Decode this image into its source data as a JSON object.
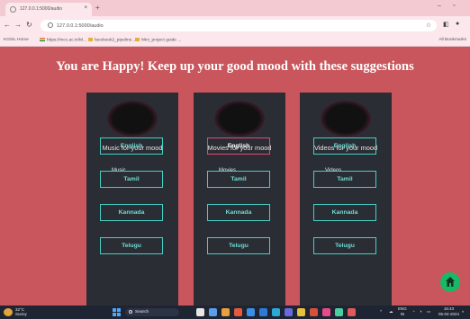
{
  "browser": {
    "tab_title": "127.0.0.1:5000/audio",
    "tab_close": "×",
    "new_tab": "+",
    "url": "127.0.0.1:5000/audio",
    "bookmarks": [
      "KGiSL Home",
      "https://mcc.ac.in/M...",
      "facebook2_pipeline...",
      "Mini_project guide ..."
    ],
    "all_bookmarks": "All Bookmarks"
  },
  "page": {
    "headline": "You are Happy! Keep up your good mood with these suggestions",
    "cards": [
      {
        "title": "Music for your mood",
        "subtitle": "Music",
        "buttons": [
          "English",
          "Tamil",
          "Kannada",
          "Telugu"
        ],
        "active_index": -1
      },
      {
        "title": "Movies for your mood",
        "subtitle": "Movies",
        "buttons": [
          "English",
          "Tamil",
          "Kannada",
          "Telugu"
        ],
        "active_index": 0
      },
      {
        "title": "Videos for your mood",
        "subtitle": "Videos",
        "buttons": [
          "English",
          "Tamil",
          "Kannada",
          "Telugu"
        ],
        "active_index": -1
      }
    ]
  },
  "taskbar": {
    "temperature": "32°C",
    "weather": "Sunny",
    "search_placeholder": "Search",
    "language": "ENG",
    "region": "IN",
    "time": "16:43",
    "date": "05-04-2024"
  },
  "colors": {
    "page_background": "#c9565c",
    "card_background": "#2b2d34",
    "button_border": "#44cfc6",
    "active_button_border": "#e04a77",
    "fab": "#18b866"
  }
}
